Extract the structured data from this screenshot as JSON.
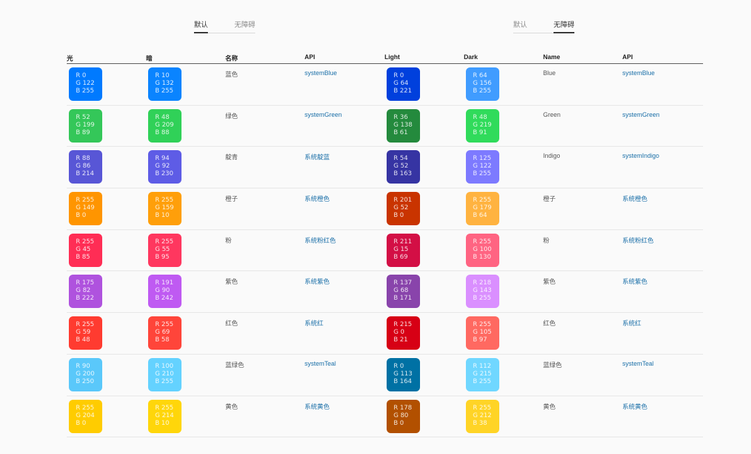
{
  "left": {
    "tabs": [
      {
        "label": "默认",
        "active": true
      },
      {
        "label": "无障碍",
        "active": false
      }
    ],
    "headers": [
      "光",
      "暗",
      "名称",
      "API"
    ],
    "rows": [
      {
        "c1": {
          "hex": "#007AFF",
          "r": "R 0",
          "g": "G 122",
          "b": "B 255"
        },
        "c2": {
          "hex": "#0A84FF",
          "r": "R 10",
          "g": "G 132",
          "b": "B 255"
        },
        "name": "蓝色",
        "api": "systemBlue"
      },
      {
        "c1": {
          "hex": "#34C759",
          "r": "R 52",
          "g": "G 199",
          "b": "B 89"
        },
        "c2": {
          "hex": "#30D158",
          "r": "R 48",
          "g": "G 209",
          "b": "B 88"
        },
        "name": "绿色",
        "api": "systemGreen"
      },
      {
        "c1": {
          "hex": "#5856D6",
          "r": "R 88",
          "g": "G 86",
          "b": "B 214"
        },
        "c2": {
          "hex": "#5E5CE6",
          "r": "R 94",
          "g": "G 92",
          "b": "B 230"
        },
        "name": "靛青",
        "api": "系统靛蓝"
      },
      {
        "c1": {
          "hex": "#FF9500",
          "r": "R 255",
          "g": "G 149",
          "b": "B 0"
        },
        "c2": {
          "hex": "#FF9F0A",
          "r": "R 255",
          "g": "G 159",
          "b": "B 10"
        },
        "name": "橙子",
        "api": "系统橙色"
      },
      {
        "c1": {
          "hex": "#FF2D55",
          "r": "R 255",
          "g": "G 45",
          "b": "B 85"
        },
        "c2": {
          "hex": "#FF375F",
          "r": "R 255",
          "g": "G 55",
          "b": "B 95"
        },
        "name": "粉",
        "api": "系统粉红色"
      },
      {
        "c1": {
          "hex": "#AF52DE",
          "r": "R 175",
          "g": "G 82",
          "b": "B 222"
        },
        "c2": {
          "hex": "#BF5AF2",
          "r": "R 191",
          "g": "G 90",
          "b": "B 242"
        },
        "name": "紫色",
        "api": "系统紫色"
      },
      {
        "c1": {
          "hex": "#FF3B30",
          "r": "R 255",
          "g": "G 59",
          "b": "B 48"
        },
        "c2": {
          "hex": "#FF453A",
          "r": "R 255",
          "g": "G 69",
          "b": "B 58"
        },
        "name": "红色",
        "api": "系统红"
      },
      {
        "c1": {
          "hex": "#5AC8FA",
          "r": "R 90",
          "g": "G 200",
          "b": "B 250"
        },
        "c2": {
          "hex": "#64D2FF",
          "r": "R 100",
          "g": "G 210",
          "b": "B 255"
        },
        "name": "蓝绿色",
        "api": "systemTeal"
      },
      {
        "c1": {
          "hex": "#FFCC00",
          "r": "R 255",
          "g": "G 204",
          "b": "B 0"
        },
        "c2": {
          "hex": "#FFD60A",
          "r": "R 255",
          "g": "G 214",
          "b": "B 10"
        },
        "name": "黄色",
        "api": "系统黄色"
      }
    ]
  },
  "right": {
    "tabs": [
      {
        "label": "默认",
        "active": false
      },
      {
        "label": "无障碍",
        "active": true
      }
    ],
    "headers": [
      "Light",
      "Dark",
      "Name",
      "API"
    ],
    "rows": [
      {
        "c1": {
          "hex": "#0040DD",
          "r": "R 0",
          "g": "G 64",
          "b": "B 221"
        },
        "c2": {
          "hex": "#409CFF",
          "r": "R 64",
          "g": "G 156",
          "b": "B 255"
        },
        "name": "Blue",
        "api": "systemBlue"
      },
      {
        "c1": {
          "hex": "#248A3D",
          "r": "R 36",
          "g": "G 138",
          "b": "B 61"
        },
        "c2": {
          "hex": "#30DB5B",
          "r": "R 48",
          "g": "G 219",
          "b": "B 91"
        },
        "name": "Green",
        "api": "systemGreen"
      },
      {
        "c1": {
          "hex": "#3634A3",
          "r": "R 54",
          "g": "G 52",
          "b": "B 163"
        },
        "c2": {
          "hex": "#7D7AFF",
          "r": "R 125",
          "g": "G 122",
          "b": "B 255"
        },
        "name": "Indigo",
        "api": "systemIndigo"
      },
      {
        "c1": {
          "hex": "#C93400",
          "r": "R 201",
          "g": "G 52",
          "b": "B 0"
        },
        "c2": {
          "hex": "#FFB340",
          "r": "R 255",
          "g": "G 179",
          "b": "B 64"
        },
        "name": "橙子",
        "api": "系统橙色"
      },
      {
        "c1": {
          "hex": "#D30F45",
          "r": "R 211",
          "g": "G 15",
          "b": "B 69"
        },
        "c2": {
          "hex": "#FF6482",
          "r": "R 255",
          "g": "G 100",
          "b": "B 130"
        },
        "name": "粉",
        "api": "系统粉红色"
      },
      {
        "c1": {
          "hex": "#8944AB",
          "r": "R 137",
          "g": "G 68",
          "b": "B 171"
        },
        "c2": {
          "hex": "#DA8FFF",
          "r": "R 218",
          "g": "G 143",
          "b": "B 255"
        },
        "name": "紫色",
        "api": "系统紫色"
      },
      {
        "c1": {
          "hex": "#D70015",
          "r": "R 215",
          "g": "G 0",
          "b": "B 21"
        },
        "c2": {
          "hex": "#FF6961",
          "r": "R 255",
          "g": "G 105",
          "b": "B 97"
        },
        "name": "红色",
        "api": "系统红"
      },
      {
        "c1": {
          "hex": "#0071A4",
          "r": "R 0",
          "g": "G 113",
          "b": "B 164"
        },
        "c2": {
          "hex": "#70D7FF",
          "r": "R 112",
          "g": "G 215",
          "b": "B 255"
        },
        "name": "蓝绿色",
        "api": "systemTeal"
      },
      {
        "c1": {
          "hex": "#B25000",
          "r": "R 178",
          "g": "G 80",
          "b": "B 0"
        },
        "c2": {
          "hex": "#FFD426",
          "r": "R 255",
          "g": "G 212",
          "b": "B 38"
        },
        "name": "黄色",
        "api": "系统黄色"
      }
    ]
  }
}
